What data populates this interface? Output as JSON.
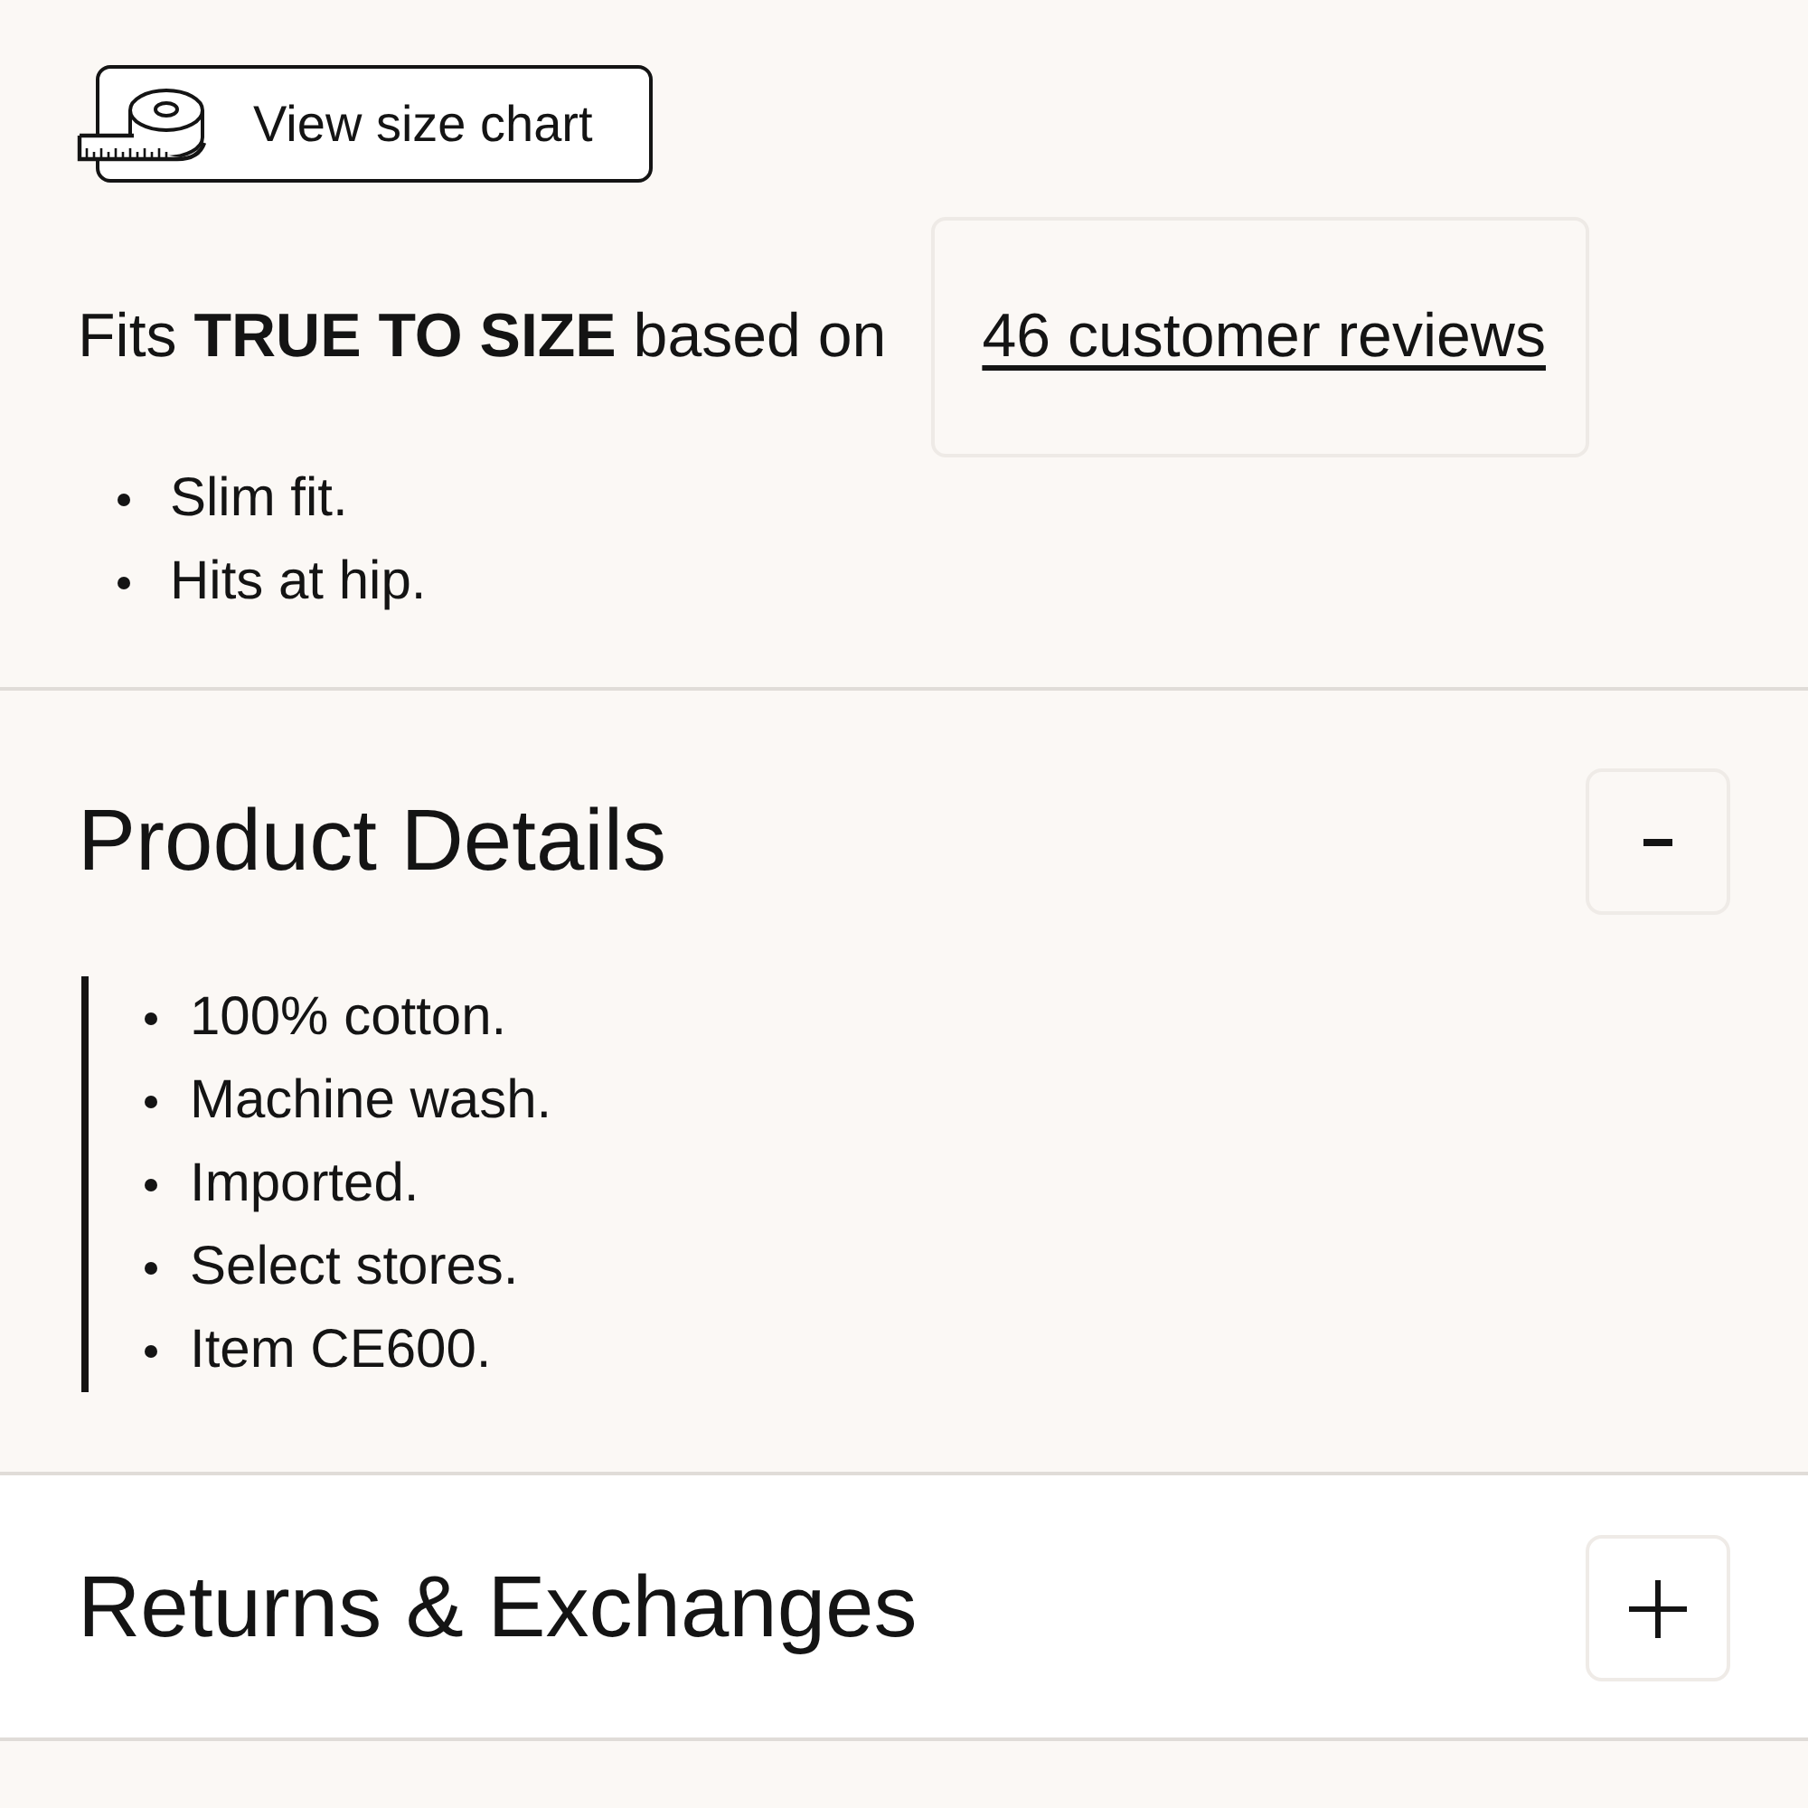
{
  "size_chart_button": {
    "label": "View size chart"
  },
  "fit": {
    "summary": "Fits **TRUE TO SIZE** based on",
    "reviews_link": "46 customer reviews",
    "notes": [
      "Slim fit.",
      "Hits at hip."
    ]
  },
  "sections": [
    {
      "title": "Product Details",
      "expanded": true,
      "items": [
        "100% cotton.",
        "Machine wash.",
        "Imported.",
        "Select stores.",
        "Item CE600."
      ]
    },
    {
      "title": "Returns & Exchanges",
      "expanded": false
    }
  ]
}
